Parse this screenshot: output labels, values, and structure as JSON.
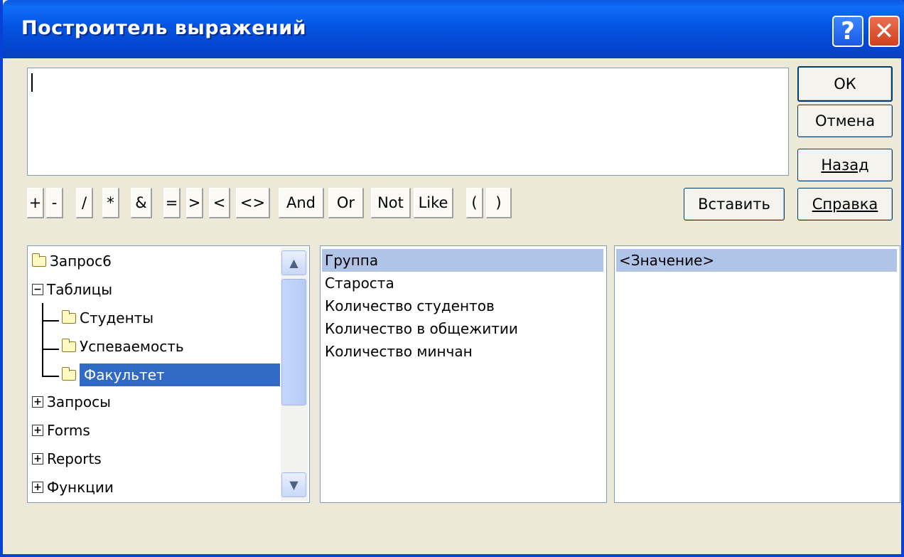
{
  "window": {
    "title": "Построитель выражений",
    "help_glyph": "?",
    "close_glyph": "✕"
  },
  "buttons": {
    "ok": "ОК",
    "cancel": "Отмена",
    "back": "Назад",
    "help": "Справка",
    "insert": "Вставить"
  },
  "operators": [
    "+",
    "-",
    "/",
    "*",
    "&",
    "=",
    ">",
    "<",
    "<>",
    "And",
    "Or",
    "Not",
    "Like",
    "(",
    ")"
  ],
  "tree": {
    "items": [
      {
        "label": "Запрос6",
        "icon": "folder-closed-icon"
      },
      {
        "label": "Таблицы",
        "icon": "collapse-icon"
      },
      {
        "label": "Студенты",
        "icon": "folder-closed-icon"
      },
      {
        "label": "Успеваемость",
        "icon": "folder-closed-icon"
      },
      {
        "label": "Факультет",
        "icon": "folder-open-icon",
        "selected": true
      },
      {
        "label": "Запросы",
        "icon": "expand-icon"
      },
      {
        "label": "Forms",
        "icon": "expand-icon"
      },
      {
        "label": "Reports",
        "icon": "expand-icon"
      },
      {
        "label": "Функции",
        "icon": "expand-icon"
      }
    ]
  },
  "fields": [
    "Группа",
    "Староста",
    "Количество студентов",
    "Количество в общежитии",
    "Количество минчан"
  ],
  "values": [
    "<Значение>"
  ],
  "colors": {
    "title_bar": "#0454e2",
    "dialog_bg": "#ece9d8",
    "selection": "#316ac5",
    "highlight": "#b0c4e8"
  }
}
